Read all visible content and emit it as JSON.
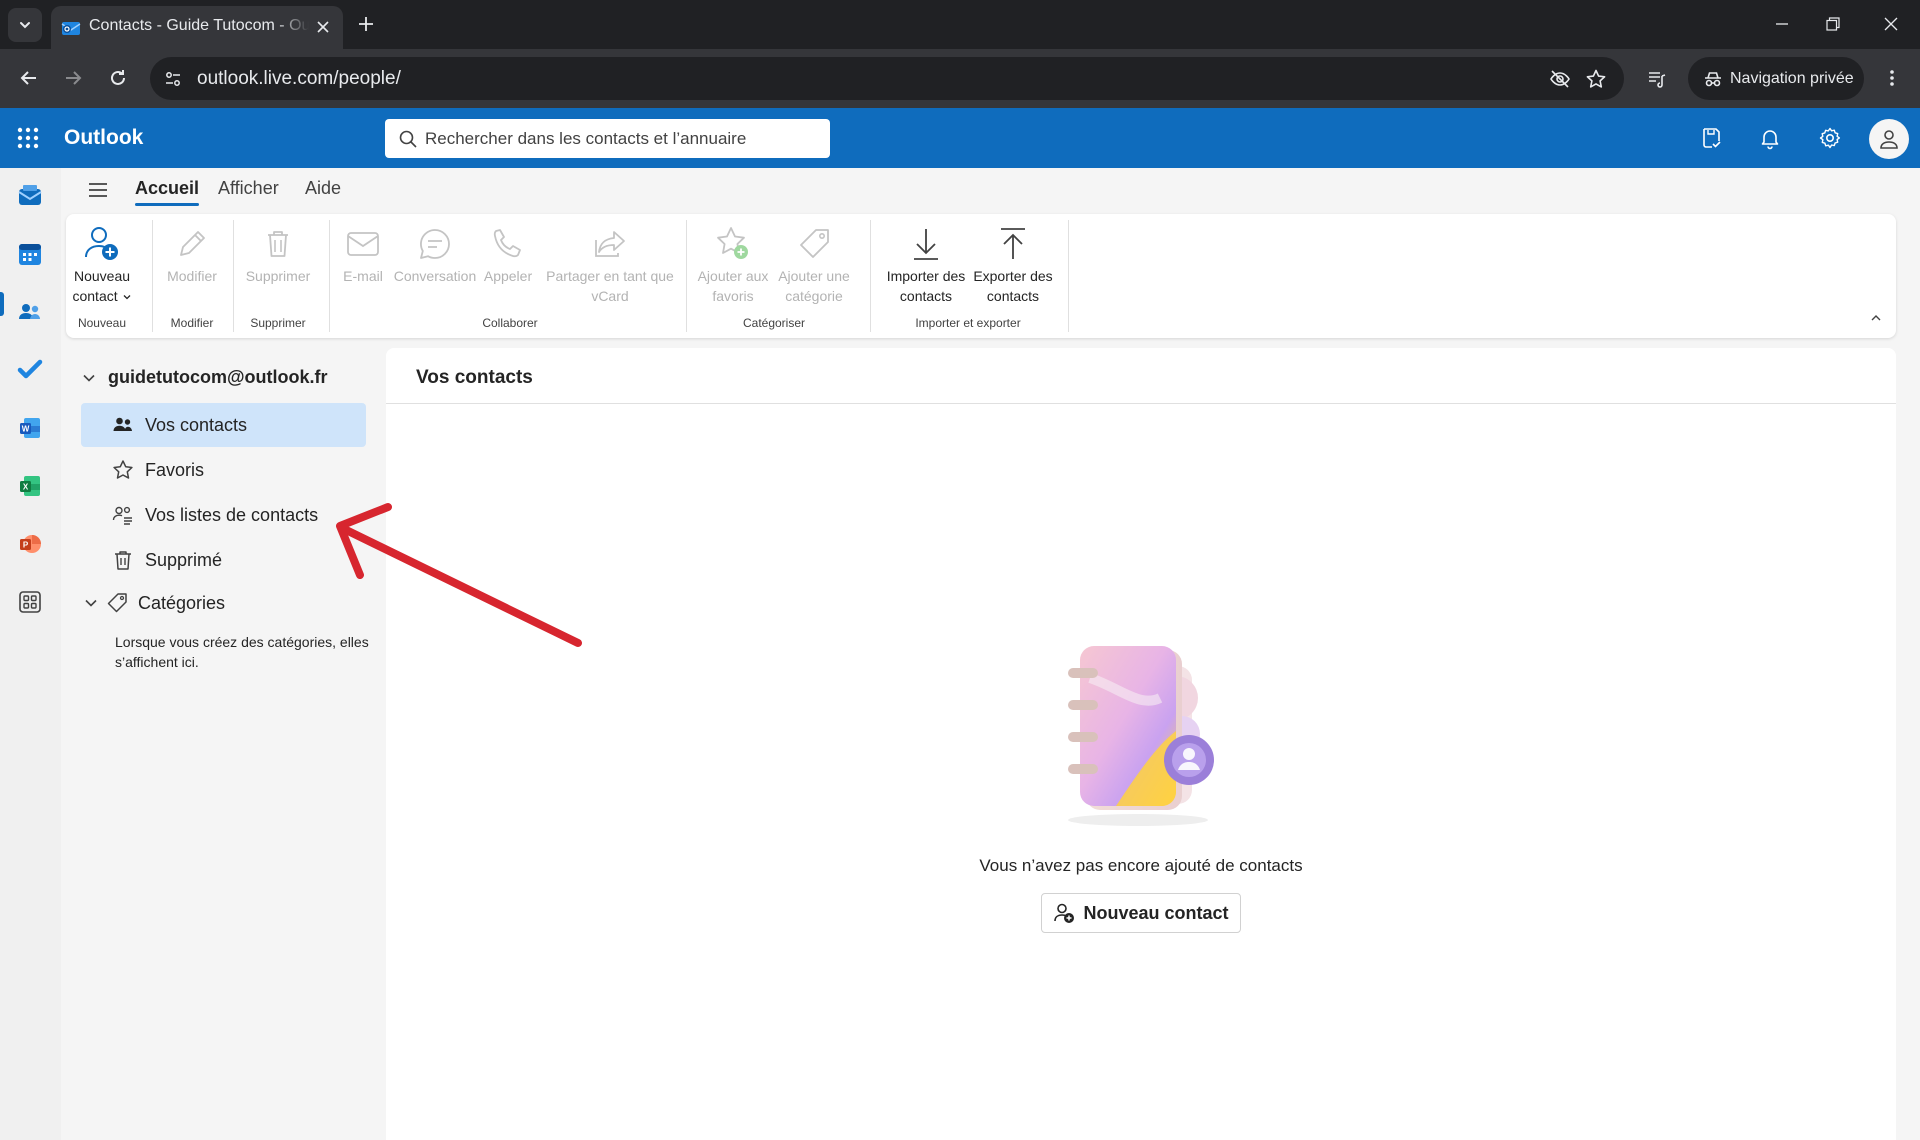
{
  "browser": {
    "tab_title": "Contacts - Guide Tutocom - Outlook",
    "url": "outlook.live.com/people/",
    "private_label": "Navigation privée"
  },
  "header": {
    "app_name": "Outlook",
    "search_placeholder": "Rechercher dans les contacts et l’annuaire",
    "brand_color": "#0f6cbd"
  },
  "tabs": [
    {
      "label": "Accueil",
      "active": true
    },
    {
      "label": "Afficher",
      "active": false
    },
    {
      "label": "Aide",
      "active": false
    }
  ],
  "ribbon": {
    "new_contact": {
      "line1": "Nouveau",
      "line2": "contact"
    },
    "edit": "Modifier",
    "delete": "Supprimer",
    "email": "E-mail",
    "chat": "Conversation",
    "call": "Appeler",
    "share": {
      "line1": "Partager en tant que",
      "line2": "vCard"
    },
    "add_favorites": {
      "line1": "Ajouter aux",
      "line2": "favoris"
    },
    "add_category": {
      "line1": "Ajouter une",
      "line2": "catégorie"
    },
    "import": {
      "line1": "Importer des",
      "line2": "contacts"
    },
    "export": {
      "line1": "Exporter des",
      "line2": "contacts"
    },
    "groups": {
      "new": "Nouveau",
      "edit": "Modifier",
      "delete": "Supprimer",
      "collaborate": "Collaborer",
      "categorize": "Catégoriser",
      "import_export": "Importer et exporter"
    }
  },
  "sidebar": {
    "account": "guidetutocom@outlook.fr",
    "items": [
      {
        "label": "Vos contacts",
        "icon": "people-icon",
        "selected": true
      },
      {
        "label": "Favoris",
        "icon": "star-icon",
        "selected": false
      },
      {
        "label": "Vos listes de contacts",
        "icon": "contact-list-icon",
        "selected": false
      },
      {
        "label": "Supprimé",
        "icon": "trash-icon",
        "selected": false
      }
    ],
    "categories_label": "Catégories",
    "categories_note": "Lorsque vous créez des catégories, elles s’affichent ici."
  },
  "main": {
    "title": "Vos contacts",
    "empty_message": "Vous n’avez pas encore ajouté de contacts",
    "new_contact_button": "Nouveau contact"
  },
  "annotation": {
    "color": "#d7262f"
  }
}
